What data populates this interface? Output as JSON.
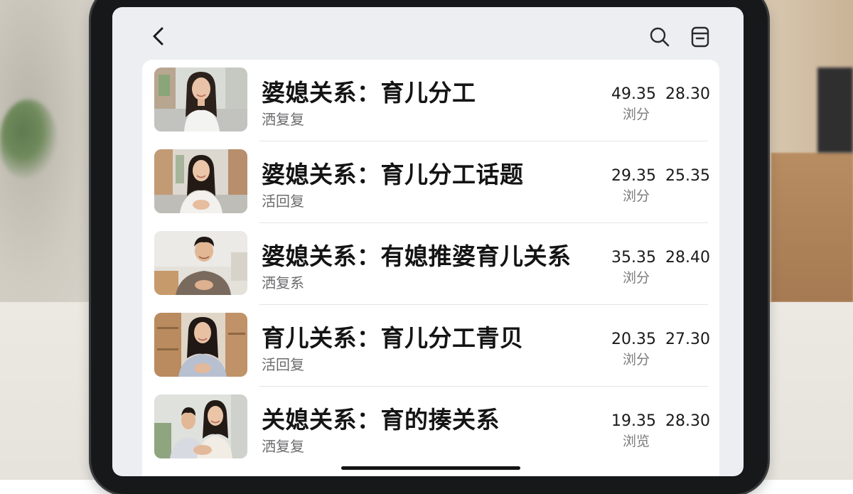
{
  "header": {
    "back_icon": "chevron-left-icon",
    "search_icon": "search-icon",
    "doc_icon": "document-icon"
  },
  "list": [
    {
      "title": "婆媳关系：育儿分工",
      "subtitle": "洒复复",
      "stat_a": "49.35",
      "stat_b": "28.30",
      "stat_label": "浏分",
      "thumb": "woman-street-photo"
    },
    {
      "title": "婆媳关系：育儿分工话题",
      "subtitle": "活回复",
      "stat_a": "29.35",
      "stat_b": "25.35",
      "stat_label": "浏分",
      "thumb": "woman-street-photo"
    },
    {
      "title": "婆媳关系：有媳推婆育儿关系",
      "subtitle": "洒复系",
      "stat_a": "35.35",
      "stat_b": "28.40",
      "stat_label": "浏分",
      "thumb": "man-room-photo"
    },
    {
      "title": "育儿关系：育儿分工青贝",
      "subtitle": "活回复",
      "stat_a": "20.35",
      "stat_b": "27.30",
      "stat_label": "浏分",
      "thumb": "woman-shelf-photo"
    },
    {
      "title": "关媳关系：育的揍关系",
      "subtitle": "洒复复",
      "stat_a": "19.35",
      "stat_b": "28.30",
      "stat_label": "浏览",
      "thumb": "two-women-photo"
    }
  ],
  "colors": {
    "screen_bg": "#eceef1",
    "card_bg": "#ffffff",
    "title_text": "#141414",
    "muted_text": "#6b6b6e"
  }
}
